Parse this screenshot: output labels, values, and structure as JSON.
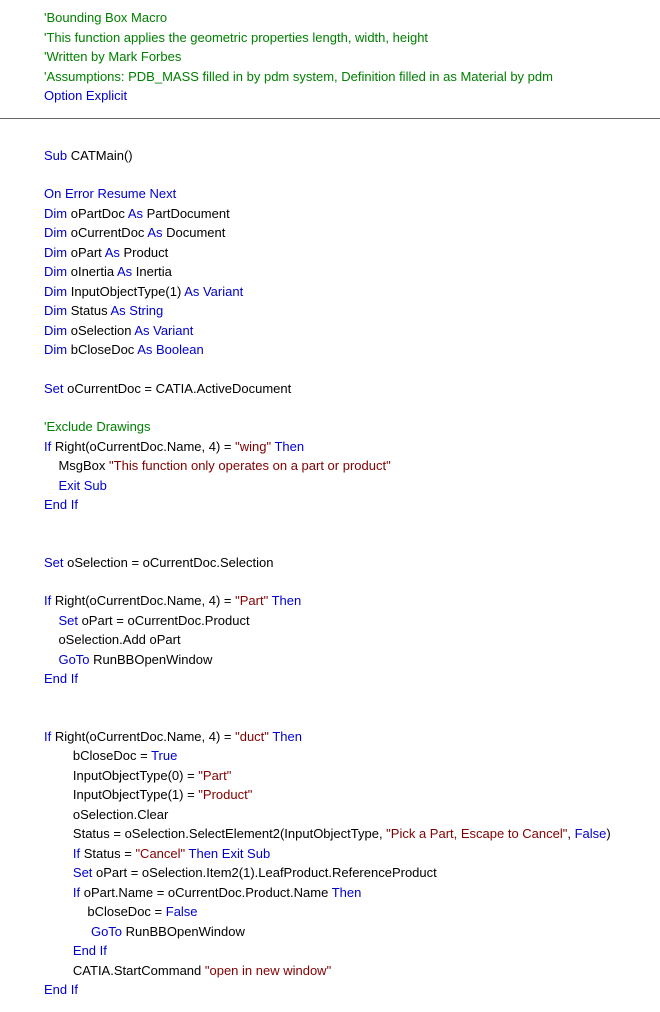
{
  "lines": [
    {
      "segs": [
        {
          "cls": "c",
          "key": "c1"
        }
      ]
    },
    {
      "segs": [
        {
          "cls": "c",
          "key": "c2"
        }
      ]
    },
    {
      "segs": [
        {
          "cls": "c",
          "key": "c3"
        }
      ]
    },
    {
      "segs": [
        {
          "cls": "c",
          "key": "c4"
        }
      ]
    },
    {
      "segs": [
        {
          "cls": "k",
          "key": "k_option_explicit"
        }
      ]
    },
    "HR",
    "BLANK",
    {
      "segs": [
        {
          "cls": "k",
          "key": "k_sub"
        },
        {
          "cls": "t",
          "key": "t_catmain"
        }
      ]
    },
    "BLANK",
    {
      "segs": [
        {
          "cls": "k",
          "key": "k_on_error"
        }
      ]
    },
    {
      "segs": [
        {
          "cls": "k",
          "key": "k_dim"
        },
        {
          "cls": "t",
          "key": "t_opartdoc"
        },
        {
          "cls": "k",
          "key": "k_as"
        },
        {
          "cls": "t",
          "key": "t_partdocument"
        }
      ]
    },
    {
      "segs": [
        {
          "cls": "k",
          "key": "k_dim"
        },
        {
          "cls": "t",
          "key": "t_ocurrentdoc"
        },
        {
          "cls": "k",
          "key": "k_as"
        },
        {
          "cls": "t",
          "key": "t_document"
        }
      ]
    },
    {
      "segs": [
        {
          "cls": "k",
          "key": "k_dim"
        },
        {
          "cls": "t",
          "key": "t_opart"
        },
        {
          "cls": "k",
          "key": "k_as"
        },
        {
          "cls": "t",
          "key": "t_product"
        }
      ]
    },
    {
      "segs": [
        {
          "cls": "k",
          "key": "k_dim"
        },
        {
          "cls": "t",
          "key": "t_oinertia"
        },
        {
          "cls": "k",
          "key": "k_as"
        },
        {
          "cls": "t",
          "key": "t_inertia"
        }
      ]
    },
    {
      "segs": [
        {
          "cls": "k",
          "key": "k_dim"
        },
        {
          "cls": "t",
          "key": "t_inputobjecttype"
        },
        {
          "cls": "k",
          "key": "k_as_variant"
        }
      ]
    },
    {
      "segs": [
        {
          "cls": "k",
          "key": "k_dim"
        },
        {
          "cls": "t",
          "key": "t_status"
        },
        {
          "cls": "k",
          "key": "k_as_string"
        }
      ]
    },
    {
      "segs": [
        {
          "cls": "k",
          "key": "k_dim"
        },
        {
          "cls": "t",
          "key": "t_oselection"
        },
        {
          "cls": "k",
          "key": "k_as_variant2"
        }
      ]
    },
    {
      "segs": [
        {
          "cls": "k",
          "key": "k_dim"
        },
        {
          "cls": "t",
          "key": "t_bclosedoc"
        },
        {
          "cls": "k",
          "key": "k_as_boolean"
        }
      ]
    },
    "BLANK",
    {
      "segs": [
        {
          "cls": "k",
          "key": "k_set"
        },
        {
          "cls": "t",
          "key": "t_set_currentdoc"
        }
      ]
    },
    "BLANK",
    {
      "segs": [
        {
          "cls": "c",
          "key": "c_exclude"
        }
      ]
    },
    {
      "segs": [
        {
          "cls": "k",
          "key": "k_if"
        },
        {
          "cls": "t",
          "key": "t_if_wing_a"
        },
        {
          "cls": "s",
          "key": "s_wing"
        },
        {
          "cls": "t",
          "key": "t_sp"
        },
        {
          "cls": "k",
          "key": "k_then"
        }
      ]
    },
    {
      "segs": [
        {
          "cls": "t",
          "key": "t_indent1"
        },
        {
          "cls": "t",
          "key": "t_msgbox"
        },
        {
          "cls": "s",
          "key": "s_msgonly"
        }
      ]
    },
    {
      "segs": [
        {
          "cls": "t",
          "key": "t_indent1"
        },
        {
          "cls": "k",
          "key": "k_exit_sub"
        }
      ]
    },
    {
      "segs": [
        {
          "cls": "k",
          "key": "k_end_if"
        }
      ]
    },
    "BLANK",
    "BLANK",
    {
      "segs": [
        {
          "cls": "k",
          "key": "k_set"
        },
        {
          "cls": "t",
          "key": "t_set_oselection"
        }
      ]
    },
    "BLANK",
    {
      "segs": [
        {
          "cls": "k",
          "key": "k_if"
        },
        {
          "cls": "t",
          "key": "t_if_part_a"
        },
        {
          "cls": "s",
          "key": "s_part"
        },
        {
          "cls": "t",
          "key": "t_sp"
        },
        {
          "cls": "k",
          "key": "k_then"
        }
      ]
    },
    {
      "segs": [
        {
          "cls": "t",
          "key": "t_indent1"
        },
        {
          "cls": "k",
          "key": "k_set"
        },
        {
          "cls": "t",
          "key": "t_set_opart_prod"
        }
      ]
    },
    {
      "segs": [
        {
          "cls": "t",
          "key": "t_indent1"
        },
        {
          "cls": "t",
          "key": "t_oselection_add"
        }
      ]
    },
    {
      "segs": [
        {
          "cls": "t",
          "key": "t_indent1"
        },
        {
          "cls": "k",
          "key": "k_goto"
        },
        {
          "cls": "t",
          "key": "t_runbb"
        }
      ]
    },
    {
      "segs": [
        {
          "cls": "k",
          "key": "k_end_if"
        }
      ]
    },
    "BLANK",
    "BLANK",
    {
      "segs": [
        {
          "cls": "k",
          "key": "k_if"
        },
        {
          "cls": "t",
          "key": "t_if_duct_a"
        },
        {
          "cls": "s",
          "key": "s_duct"
        },
        {
          "cls": "t",
          "key": "t_sp"
        },
        {
          "cls": "k",
          "key": "k_then"
        }
      ]
    },
    {
      "segs": [
        {
          "cls": "t",
          "key": "t_indent2"
        },
        {
          "cls": "t",
          "key": "t_bclosedoc_true_a"
        },
        {
          "cls": "k",
          "key": "k_true"
        }
      ]
    },
    {
      "segs": [
        {
          "cls": "t",
          "key": "t_indent2"
        },
        {
          "cls": "t",
          "key": "t_inputobj0"
        },
        {
          "cls": "s",
          "key": "s_partq"
        }
      ]
    },
    {
      "segs": [
        {
          "cls": "t",
          "key": "t_indent2"
        },
        {
          "cls": "t",
          "key": "t_inputobj1"
        },
        {
          "cls": "s",
          "key": "s_productq"
        }
      ]
    },
    {
      "segs": [
        {
          "cls": "t",
          "key": "t_indent2"
        },
        {
          "cls": "t",
          "key": "t_oselection_clear"
        }
      ]
    },
    {
      "segs": [
        {
          "cls": "t",
          "key": "t_indent2"
        },
        {
          "cls": "t",
          "key": "t_status_eq"
        },
        {
          "cls": "s",
          "key": "s_pick"
        },
        {
          "cls": "t",
          "key": "t_comma_sp"
        },
        {
          "cls": "k",
          "key": "k_false"
        },
        {
          "cls": "t",
          "key": "t_close_paren"
        }
      ]
    },
    {
      "segs": [
        {
          "cls": "t",
          "key": "t_indent2"
        },
        {
          "cls": "k",
          "key": "k_if"
        },
        {
          "cls": "t",
          "key": "t_status_cancel_a"
        },
        {
          "cls": "s",
          "key": "s_cancel"
        },
        {
          "cls": "t",
          "key": "t_sp"
        },
        {
          "cls": "k",
          "key": "k_then_exit_sub"
        }
      ]
    },
    {
      "segs": [
        {
          "cls": "t",
          "key": "t_indent2"
        },
        {
          "cls": "k",
          "key": "k_set"
        },
        {
          "cls": "t",
          "key": "t_set_opart_leaf"
        }
      ]
    },
    {
      "segs": [
        {
          "cls": "t",
          "key": "t_indent2"
        },
        {
          "cls": "k",
          "key": "k_if"
        },
        {
          "cls": "t",
          "key": "t_opart_name_eq"
        },
        {
          "cls": "k",
          "key": "k_then"
        }
      ]
    },
    {
      "segs": [
        {
          "cls": "t",
          "key": "t_indent3"
        },
        {
          "cls": "t",
          "key": "t_bclosedoc_false_a"
        },
        {
          "cls": "k",
          "key": "k_false"
        }
      ]
    },
    {
      "segs": [
        {
          "cls": "t",
          "key": "t_indent3b"
        },
        {
          "cls": "k",
          "key": "k_goto"
        },
        {
          "cls": "t",
          "key": "t_runbb"
        }
      ]
    },
    {
      "segs": [
        {
          "cls": "t",
          "key": "t_indent2"
        },
        {
          "cls": "k",
          "key": "k_end_if"
        }
      ]
    },
    {
      "segs": [
        {
          "cls": "t",
          "key": "t_indent2"
        },
        {
          "cls": "t",
          "key": "t_catia_start"
        },
        {
          "cls": "s",
          "key": "s_open_new"
        }
      ]
    },
    {
      "segs": [
        {
          "cls": "k",
          "key": "k_end_if"
        }
      ]
    }
  ],
  "text": {
    "c1": "'Bounding Box Macro",
    "c2": "'This function applies the geometric properties length, width, height",
    "c3": "'Written by Mark Forbes",
    "c4": "'Assumptions: PDB_MASS filled in by pdm system, Definition filled in as Material by pdm",
    "c_exclude": "'Exclude Drawings",
    "k_option_explicit": "Option Explicit",
    "k_sub": "Sub",
    "t_catmain": " CATMain()",
    "k_on_error": "On Error Resume Next",
    "k_dim": "Dim",
    "k_as": "As",
    "k_set": "Set",
    "k_if": "If",
    "k_then": "Then",
    "k_then_exit_sub": "Then Exit Sub",
    "k_goto": "GoTo",
    "k_end_if": "End If",
    "k_exit_sub": "Exit Sub",
    "k_true": "True",
    "k_false": "False",
    "k_as_variant": "As Variant",
    "k_as_variant2": "As Variant",
    "k_as_string": "As String",
    "k_as_boolean": "As Boolean",
    "t_opartdoc": " oPartDoc ",
    "t_partdocument": " PartDocument",
    "t_ocurrentdoc": " oCurrentDoc ",
    "t_document": " Document",
    "t_opart": " oPart ",
    "t_product": " Product",
    "t_oinertia": " oInertia ",
    "t_inertia": " Inertia",
    "t_inputobjecttype": " InputObjectType(1) ",
    "t_status": " Status ",
    "t_oselection": " oSelection ",
    "t_bclosedoc": " bCloseDoc ",
    "t_set_currentdoc": " oCurrentDoc = CATIA.ActiveDocument",
    "t_if_wing_a": " Right(oCurrentDoc.Name, 4) = ",
    "s_wing": "\"wing\"",
    "t_sp": " ",
    "t_indent1": "    ",
    "t_indent2": "        ",
    "t_indent3": "            ",
    "t_indent3b": "             ",
    "t_msgbox": "MsgBox ",
    "s_msgonly": "\"This function only operates on a part or product\"",
    "t_set_oselection": " oSelection = oCurrentDoc.Selection",
    "t_if_part_a": " Right(oCurrentDoc.Name, 4) = ",
    "s_part": "\"Part\"",
    "t_set_opart_prod": " oPart = oCurrentDoc.Product",
    "t_oselection_add": "oSelection.Add oPart",
    "t_runbb": " RunBBOpenWindow",
    "t_if_duct_a": " Right(oCurrentDoc.Name, 4) = ",
    "s_duct": "\"duct\"",
    "t_bclosedoc_true_a": "bCloseDoc = ",
    "t_inputobj0": "InputObjectType(0) = ",
    "s_partq": "\"Part\"",
    "t_inputobj1": "InputObjectType(1) = ",
    "s_productq": "\"Product\"",
    "t_oselection_clear": "oSelection.Clear",
    "t_status_eq": "Status = oSelection.SelectElement2(InputObjectType, ",
    "s_pick": "\"Pick a Part, Escape to Cancel\"",
    "t_comma_sp": ", ",
    "t_close_paren": ")",
    "t_status_cancel_a": " Status = ",
    "s_cancel": "\"Cancel\"",
    "t_set_opart_leaf": " oPart = oSelection.Item2(1).LeafProduct.ReferenceProduct",
    "t_opart_name_eq": " oPart.Name = oCurrentDoc.Product.Name ",
    "t_bclosedoc_false_a": "bCloseDoc = ",
    "t_catia_start": "CATIA.StartCommand ",
    "s_open_new": "\"open in new window\""
  }
}
